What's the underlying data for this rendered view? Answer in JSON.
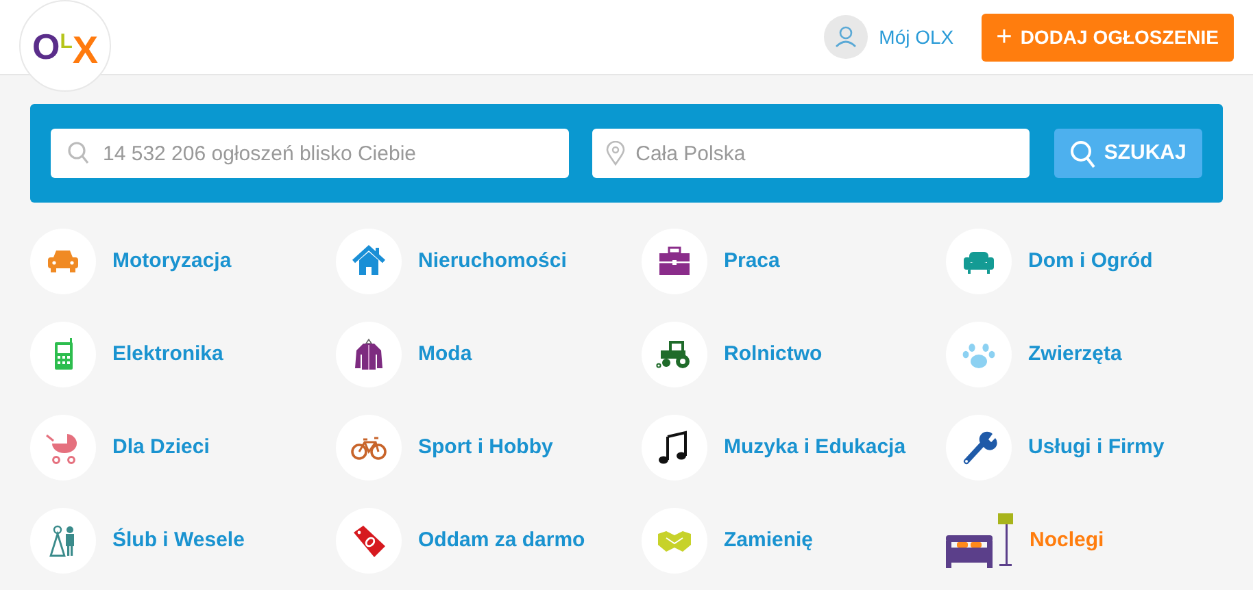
{
  "header": {
    "logo": [
      "O",
      "L",
      "X"
    ],
    "account_link": "Mój OLX",
    "post_ad_button": {
      "icon": "+",
      "label": "DODAJ OGŁOSZENIE"
    }
  },
  "search": {
    "query_placeholder": "14 532 206 ogłoszeń blisko Ciebie",
    "location_placeholder": "Cała Polska",
    "button": "SZUKAJ"
  },
  "categories": [
    {
      "label": "Motoryzacja",
      "featured": false
    },
    {
      "label": "Nieruchomości",
      "featured": false
    },
    {
      "label": "Praca",
      "featured": false
    },
    {
      "label": "Dom i Ogród",
      "featured": false
    },
    {
      "label": "Elektronika",
      "featured": false
    },
    {
      "label": "Moda",
      "featured": false
    },
    {
      "label": "Rolnictwo",
      "featured": false
    },
    {
      "label": "Zwierzęta",
      "featured": false
    },
    {
      "label": "Dla Dzieci",
      "featured": false
    },
    {
      "label": "Sport i Hobby",
      "featured": false
    },
    {
      "label": "Muzyka i Edukacja",
      "featured": false
    },
    {
      "label": "Usługi i Firmy",
      "featured": false
    },
    {
      "label": "Ślub i Wesele",
      "featured": false
    },
    {
      "label": "Oddam za darmo",
      "featured": false
    },
    {
      "label": "Zamienię",
      "featured": false
    },
    {
      "label": "Noclegi",
      "featured": true
    }
  ]
}
